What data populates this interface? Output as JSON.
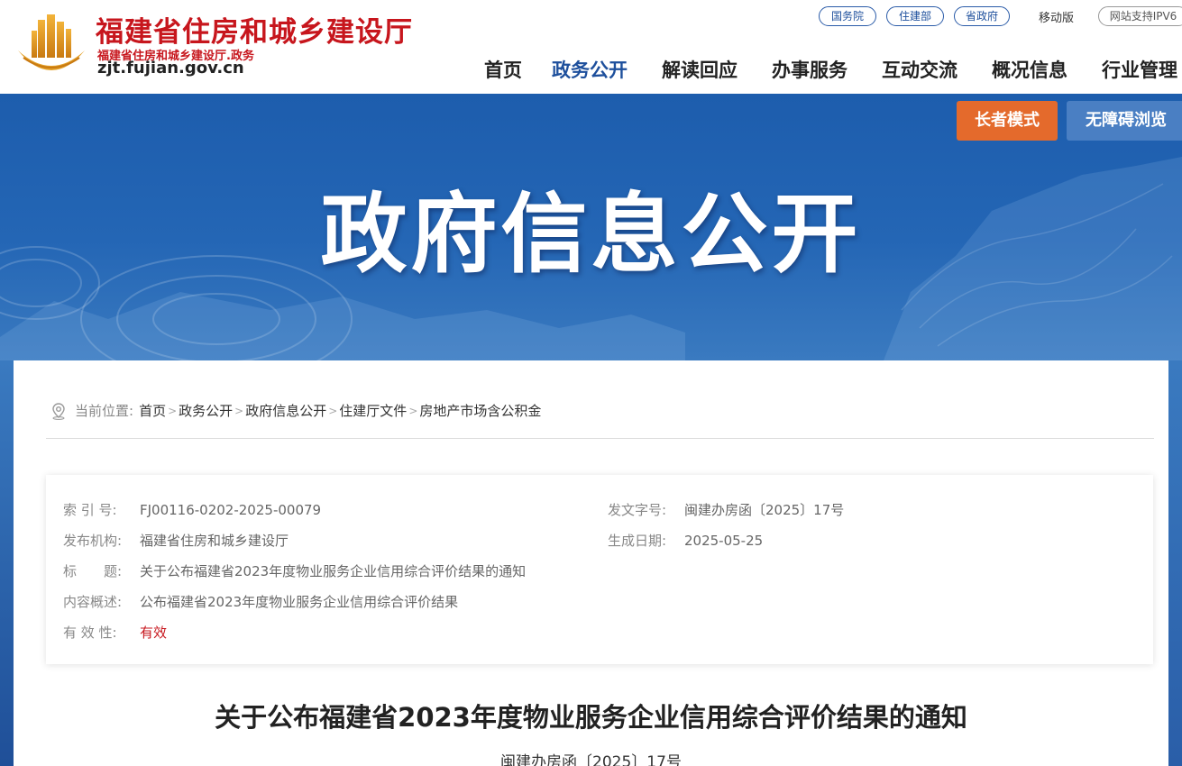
{
  "header": {
    "title": "福建省住房和城乡建设厅",
    "subtitle": "福建省住房和城乡建设厅.政务",
    "url": "zjt.fujian.gov.cn",
    "top_links": [
      "国务院",
      "住建部",
      "省政府"
    ],
    "mobile": "移动版",
    "ipv6": "网站支持IPV6"
  },
  "nav": {
    "items": [
      "首页",
      "政务公开",
      "解读回应",
      "办事服务",
      "互动交流",
      "概况信息",
      "行业管理"
    ],
    "active": "政务公开"
  },
  "banner": {
    "title": "政府信息公开",
    "elder_mode": "长者模式",
    "accessible": "无障碍浏览"
  },
  "breadcrumb": {
    "label": "当前位置:",
    "items": [
      "首页",
      "政务公开",
      "政府信息公开",
      "住建厅文件",
      "房地产市场含公积金"
    ]
  },
  "meta": {
    "index_label": "索 引 号:",
    "index_value": "FJ00116-0202-2025-00079",
    "doc_no_label": "发文字号:",
    "doc_no_value": "闽建办房函〔2025〕17号",
    "publisher_label": "发布机构:",
    "publisher_value": "福建省住房和城乡建设厅",
    "date_label": "生成日期:",
    "date_value": "2025-05-25",
    "title_label": "标　　题:",
    "title_value": "关于公布福建省2023年度物业服务企业信用综合评价结果的通知",
    "summary_label": "内容概述:",
    "summary_value": "公布福建省2023年度物业服务企业信用综合评价结果",
    "validity_label": "有 效 性:",
    "validity_value": "有效"
  },
  "document": {
    "title": "关于公布福建省2023年度物业服务企业信用综合评价结果的通知",
    "number": "闽建办房函〔2025〕17号"
  },
  "colors": {
    "brand_red": "#c7161d",
    "brand_blue": "#1d4f9c",
    "elder_orange": "#e46a2c"
  }
}
